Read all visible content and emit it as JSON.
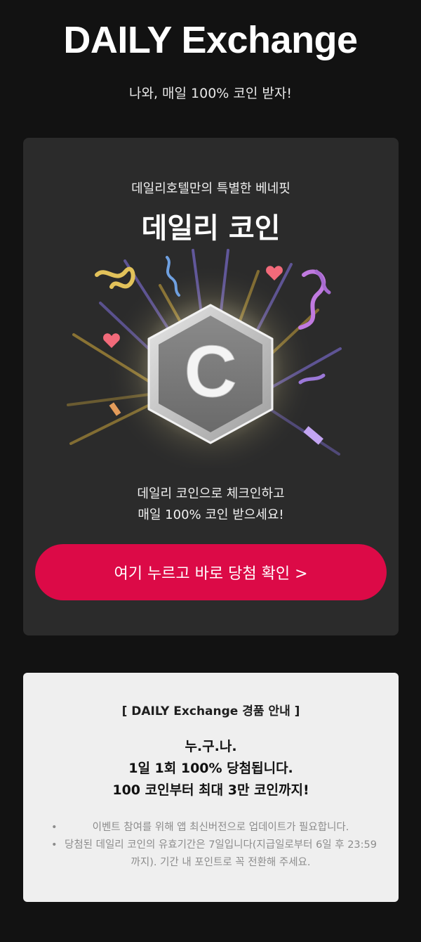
{
  "header": {
    "title": "DAILY Exchange",
    "subtitle": "나와, 매일 100% 코인 받자!"
  },
  "promo": {
    "eyebrow": "데일리호텔만의 특별한 베네핏",
    "title": "데일리 코인",
    "coin_letter": "C",
    "icons": [
      "coin-icon",
      "confetti-icon",
      "heart-icon"
    ],
    "description_line1": "데일리 코인으로 체크인하고",
    "description_line2": "매일 100% 코인 받으세요!",
    "cta_label": "여기 누르고 바로 당첨 확인 >",
    "colors": {
      "card_bg": "#2b2b2b",
      "cta_bg": "#dc0a47"
    }
  },
  "info": {
    "heading": "[ DAILY Exchange 경품 안내 ]",
    "highlight_line1": "누.구.나.",
    "highlight_line2": "1일 1회 100% 당첨됩니다.",
    "highlight_line3": "100 코인부터 최대 3만 코인까지!",
    "notices": [
      "이벤트 참여를 위해 앱 최신버전으로 업데이트가 필요합니다.",
      "당첨된 데일리 코인의 유효기간은 7일입니다(지급일로부터 6일 후 23:59까지). 기간 내 포인트로 꼭 전환해 주세요."
    ]
  }
}
